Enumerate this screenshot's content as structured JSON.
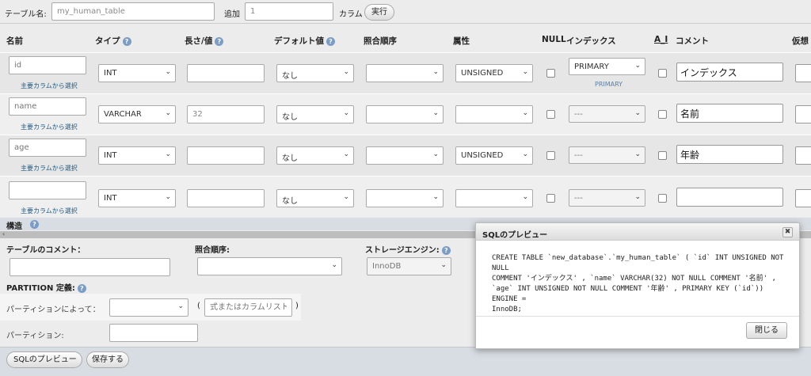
{
  "top": {
    "table_label": "テーブル名:",
    "table_name": "my_human_table",
    "add_label": "追加",
    "add_count": "1",
    "column_label": "カラム",
    "execute": "実行"
  },
  "headers": {
    "name": "名前",
    "type": "タイプ",
    "length": "長さ/値",
    "default": "デフォルト値",
    "collation": "照合順序",
    "attribute": "属性",
    "null": "NULL",
    "index": "インデックス",
    "ai": "A_I",
    "comment": "コメント",
    "virtual": "仮想"
  },
  "help_glyph": "?",
  "rows": [
    {
      "name": "",
      "name_placeholder": "id",
      "sublink": "主要カラムから選択",
      "type": "INT",
      "length": "",
      "default": "なし",
      "collation": "",
      "attribute": "UNSIGNED",
      "index": "PRIMARY",
      "index_sub": "PRIMARY",
      "comment": "インデックス"
    },
    {
      "name": "",
      "name_placeholder": "name",
      "sublink": "主要カラムから選択",
      "type": "VARCHAR",
      "length": "32",
      "default": "なし",
      "collation": "",
      "attribute": "",
      "index": "---",
      "index_sub": "",
      "comment": "名前"
    },
    {
      "name": "",
      "name_placeholder": "age",
      "sublink": "主要カラムから選択",
      "type": "INT",
      "length": "",
      "default": "なし",
      "collation": "",
      "attribute": "UNSIGNED",
      "index": "---",
      "index_sub": "",
      "comment": "年齢"
    },
    {
      "name": "",
      "name_placeholder": "",
      "sublink": "主要カラムから選択",
      "type": "INT",
      "length": "",
      "default": "なし",
      "collation": "",
      "attribute": "",
      "index": "---",
      "index_sub": "",
      "comment": ""
    }
  ],
  "structure": {
    "title": "構造",
    "table_comment_label": "テーブルのコメント：",
    "collation_label": "照合順序:",
    "engine_label": "ストレージエンジン:",
    "engine_value": "InnoDB",
    "partition_title": "PARTITION 定義:",
    "partition_by_label": "パーティションによって：",
    "partition_expr_placeholder": "式またはカラムリスト",
    "partition_open": "(",
    "partition_close": ")",
    "partitions_label": "パーティション:"
  },
  "buttons": {
    "preview": "SQLのプレビュー",
    "save": "保存する"
  },
  "modal": {
    "title": "SQLのプレビュー",
    "close": "✖",
    "close_button": "閉じる",
    "sql_line1": "CREATE TABLE `new_database`.`my_human_table` ( `id` INT UNSIGNED NOT NULL",
    "sql_line2": "COMMENT 'インデックス' , `name` VARCHAR(32) NOT NULL COMMENT '名前' ,",
    "sql_line3": "`age` INT UNSIGNED NOT NULL COMMENT '年齢' , PRIMARY KEY (`id`)) ENGINE =",
    "sql_line4": "InnoDB;"
  }
}
